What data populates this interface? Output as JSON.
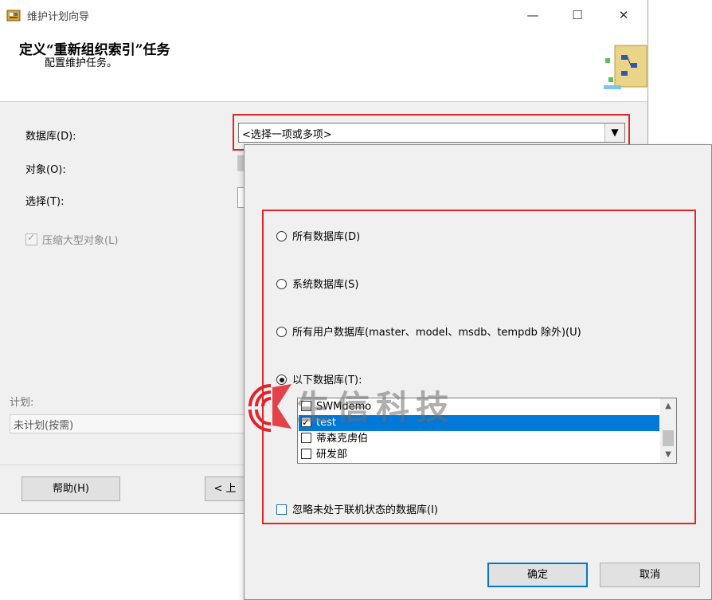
{
  "window": {
    "title": "维护计划向导",
    "minimize": "—",
    "maximize": "☐",
    "close": "✕"
  },
  "header": {
    "title": "定义“重新组织索引”任务",
    "subtitle": "配置维护任务。"
  },
  "form": {
    "database_label": "数据库(D):",
    "object_label": "对象(O):",
    "select_label": "选择(T):",
    "compress_label": "压缩大型对象(L)",
    "compress_checked": true,
    "compress_enabled": false,
    "database_combo_value": "<选择一项或多项>",
    "combo_arrow": "▼"
  },
  "schedule": {
    "label": "计划:",
    "value": "未计划(按需)"
  },
  "footer": {
    "help_label": "帮助(H)",
    "back_label_partial": "< 上"
  },
  "dropdown": {
    "options": [
      {
        "label": "所有数据库(D)",
        "checked": false
      },
      {
        "label": "系统数据库(S)",
        "checked": false
      },
      {
        "label": "所有用户数据库(master、model、msdb、tempdb 除外)(U)",
        "checked": false
      },
      {
        "label": "以下数据库(T):",
        "checked": true
      }
    ],
    "databases": [
      {
        "name": "SWMdemo",
        "checked": false,
        "selected": false
      },
      {
        "name": "test",
        "checked": true,
        "selected": true
      },
      {
        "name": "蒂森克虏伯",
        "checked": false,
        "selected": false
      },
      {
        "name": "研发部",
        "checked": false,
        "selected": false
      }
    ],
    "scroll_up": "▲",
    "scroll_down": "▼",
    "ignore_offline_label": "忽略未处于联机状态的数据库(I)",
    "ignore_offline_checked": false,
    "ok_label": "确定",
    "cancel_label": "取消"
  },
  "watermark": {
    "text": "生信科技"
  },
  "colors": {
    "highlight_box": "#e0242a",
    "selection": "#0078d7",
    "window_bg": "#f0f0f0"
  }
}
